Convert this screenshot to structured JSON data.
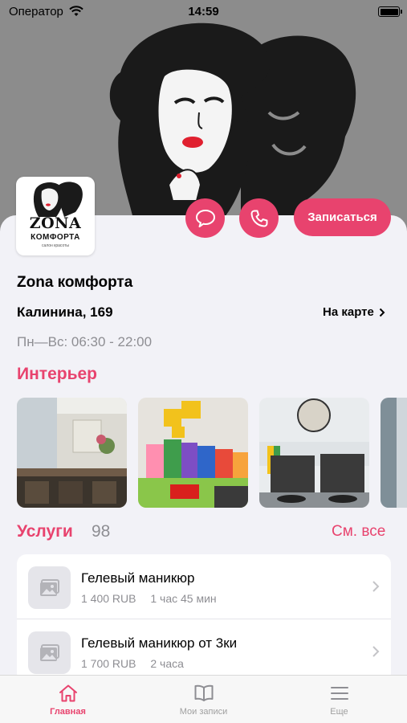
{
  "status_bar": {
    "carrier": "Оператор",
    "time": "14:59"
  },
  "salon": {
    "logo_brand": "ZONA",
    "logo_sub": "КОМФОРТА",
    "logo_tag": "салон красоты",
    "name": "Zona комфорта",
    "address": "Калинина, 169",
    "map_link": "На карте",
    "hours": "Пн—Вс: 06:30 - 22:00"
  },
  "actions": {
    "book_label": "Записаться"
  },
  "interior": {
    "title": "Интерьер",
    "photos": [
      "interior-photo-1",
      "interior-photo-2",
      "interior-photo-3",
      "interior-photo-4"
    ]
  },
  "services": {
    "title": "Услуги",
    "count": "98",
    "see_all": "См. все",
    "items": [
      {
        "name": "Гелевый маникюр",
        "price": "1 400 RUB",
        "duration": "1 час 45 мин"
      },
      {
        "name": "Гелевый маникюр от 3ки",
        "price": "1 700 RUB",
        "duration": "2 часа"
      }
    ]
  },
  "tab_bar": {
    "items": [
      {
        "label": "Главная",
        "icon": "home-icon",
        "active": true
      },
      {
        "label": "Мои записи",
        "icon": "book-icon",
        "active": false
      },
      {
        "label": "Еще",
        "icon": "menu-icon",
        "active": false
      }
    ]
  },
  "colors": {
    "accent": "#e8436e",
    "secondary_text": "#8e8e93",
    "hero_bg": "#8c8c8c"
  }
}
